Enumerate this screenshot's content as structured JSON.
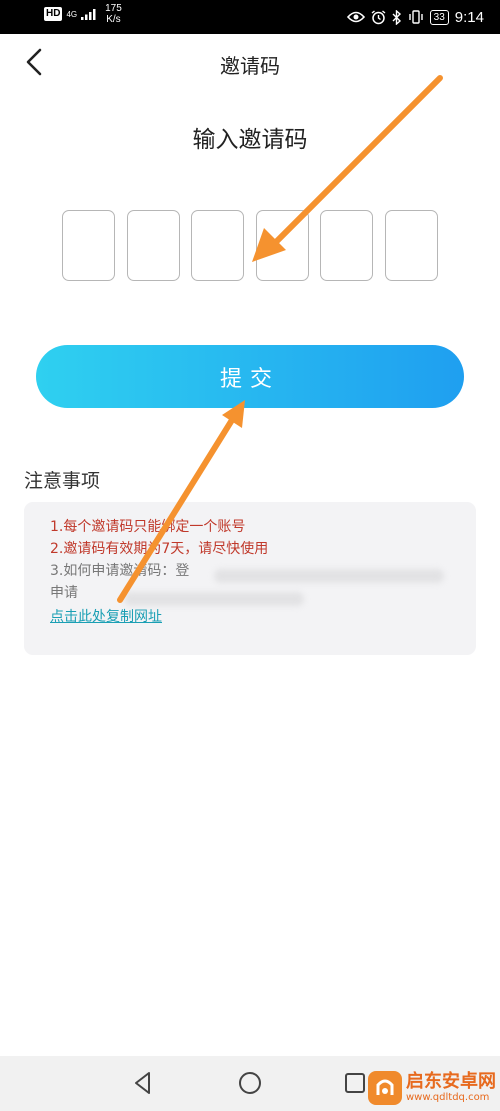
{
  "status_bar": {
    "hd": "HD",
    "network": "4G",
    "speed_value": "175",
    "speed_unit": "K/s",
    "battery": "33",
    "time": "9:14"
  },
  "header": {
    "title": "邀请码"
  },
  "main": {
    "heading": "输入邀请码",
    "code_boxes": 6,
    "submit_label": "提交"
  },
  "notice": {
    "title": "注意事项",
    "line1": "1.每个邀请码只能绑定一个账号",
    "line2": "2.邀请码有效期为7天，请尽快使用",
    "line3": "3.如何申请邀请码：登",
    "line4": "申请",
    "link": "点击此处复制网址"
  },
  "watermark": {
    "name": "启东安卓网",
    "url": "www.qdltdq.com"
  },
  "colors": {
    "button_start": "#2fd0f0",
    "button_end": "#1f9ff0",
    "notice_red": "#c0392b",
    "link": "#1a9fb4",
    "arrow": "#f5922f"
  }
}
